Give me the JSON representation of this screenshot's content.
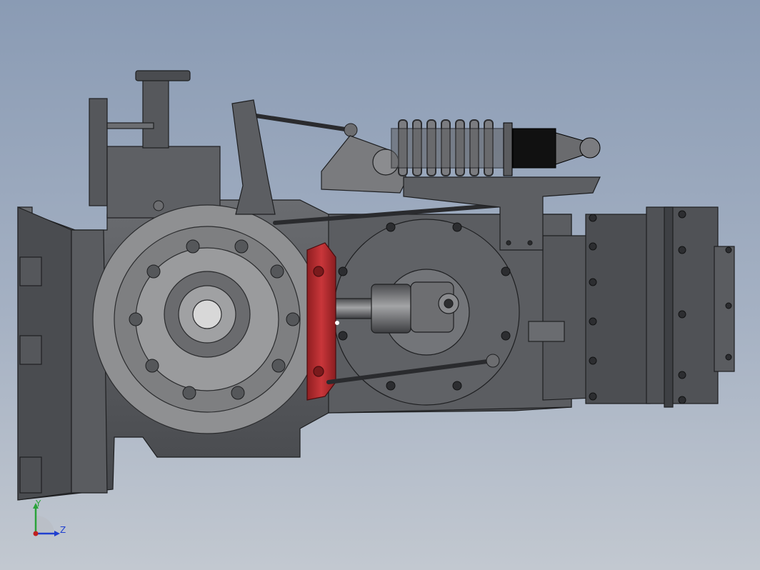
{
  "viewport": {
    "background_top": "#8a9bb4",
    "background_bottom": "#c2c8d0"
  },
  "model": {
    "body_color": "#5c5e62",
    "dark_color": "#3a3b3e",
    "light_color": "#8a8b8e",
    "disc_color": "#8c8d8f",
    "caliper_color": "#b3282b",
    "spring_color": "#6a6b6e",
    "damper_color": "#111111"
  },
  "triad": {
    "y_label": "Y",
    "z_label": "Z",
    "y_color": "#2aa33a",
    "z_color": "#2040d0",
    "origin_color": "#c02020"
  }
}
